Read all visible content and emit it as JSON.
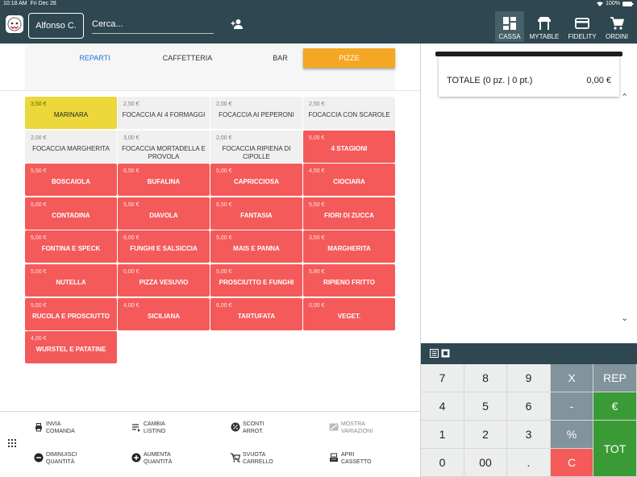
{
  "status": {
    "time": "10:18 AM",
    "date": "Fri Dec 28",
    "battery": "100%"
  },
  "header": {
    "operator": "Alfonso  C.",
    "search_placeholder": "Cerca...",
    "nav": [
      {
        "label": "CASSA",
        "icon": "dashboard-icon",
        "active": true
      },
      {
        "label": "MYTABLE",
        "icon": "table-icon"
      },
      {
        "label": "FIDELITY",
        "icon": "credit-card-icon"
      },
      {
        "label": "ORDINI",
        "icon": "cart-icon"
      }
    ]
  },
  "categories": [
    {
      "label": "REPARTI"
    },
    {
      "label": "CAFFETTERIA"
    },
    {
      "label": "BAR"
    },
    {
      "label": "PIZZE",
      "active": true
    }
  ],
  "colors": {
    "topbar": "#2e4750",
    "accent": "#f5a623",
    "product_red": "#f45a5a",
    "product_yellow": "#ecd83a",
    "product_gray": "#f0f0f0",
    "keypad_green": "#3a9b36",
    "keypad_gray": "#81939b",
    "link_blue": "#1e6fd9"
  },
  "products": [
    {
      "price": "3,50 €",
      "name": "MARINARA",
      "color": "yellow"
    },
    {
      "price": "2,50 €",
      "name": "FOCACCIA AI 4 FORMAGGI",
      "color": "gray"
    },
    {
      "price": "2,00 €",
      "name": "FOCACCIA AI PEPERONI",
      "color": "gray"
    },
    {
      "price": "2,50 €",
      "name": "FOCACCIA CON SCAROLE",
      "color": "gray"
    },
    {
      "price": "2,00 €",
      "name": "FOCACCIA MARGHERITA",
      "color": "gray"
    },
    {
      "price": "3,00 €",
      "name": "FOCACCIA MORTADELLA E PROVOLA",
      "color": "gray"
    },
    {
      "price": "2,00 €",
      "name": "FOCACCIA RIPIENA DI CIPOLLE",
      "color": "gray"
    },
    {
      "price": "5,00 €",
      "name": "4 STAGIONI",
      "color": "red"
    },
    {
      "price": "5,50 €",
      "name": "BOSCAIOLA",
      "color": "red"
    },
    {
      "price": "6,50 €",
      "name": "BUFALINA",
      "color": "red"
    },
    {
      "price": "5,00 €",
      "name": "CAPRICCIOSA",
      "color": "red"
    },
    {
      "price": "4,50 €",
      "name": "CIOCIARA",
      "color": "red"
    },
    {
      "price": "6,00 €",
      "name": "CONTADINA",
      "color": "red"
    },
    {
      "price": "5,50 €",
      "name": "DIAVOLA",
      "color": "red"
    },
    {
      "price": "6,50 €",
      "name": "FANTASIA",
      "color": "red"
    },
    {
      "price": "5,50 €",
      "name": "FIORI DI ZUCCA",
      "color": "red"
    },
    {
      "price": "5,00 €",
      "name": "FONTINA E SPECK",
      "color": "red"
    },
    {
      "price": "6,00 €",
      "name": "FUNGHI E SALSICCIA",
      "color": "red"
    },
    {
      "price": "5,00 €",
      "name": "MAIS E PANNA",
      "color": "red"
    },
    {
      "price": "3,50 €",
      "name": "MARGHERITA",
      "color": "red"
    },
    {
      "price": "5,00 €",
      "name": "NUTELLA",
      "color": "red"
    },
    {
      "price": "0,00 €",
      "name": "PIZZA VESUVIO",
      "color": "red"
    },
    {
      "price": "5,00 €",
      "name": "PROSCIUTTO E FUNGHI",
      "color": "red"
    },
    {
      "price": "5,80 €",
      "name": "RIPIENO FRITTO",
      "color": "red"
    },
    {
      "price": "5,00 €",
      "name": "RUCOLA E PROSCIUTTO",
      "color": "red"
    },
    {
      "price": "4,00 €",
      "name": "SICILIANA",
      "color": "red"
    },
    {
      "price": "6,00 €",
      "name": "TARTUFATA",
      "color": "red"
    },
    {
      "price": "0,00 €",
      "name": "VEGET.",
      "color": "red"
    },
    {
      "price": "4,00 €",
      "name": "WURSTEL E PATATINE",
      "color": "red"
    }
  ],
  "actions": [
    {
      "l1": "INVIA",
      "l2": "COMANDA",
      "icon": "printer-icon"
    },
    {
      "l1": "CAMBIA",
      "l2": "LISTINO",
      "icon": "list-icon"
    },
    {
      "l1": "SCONTI",
      "l2": "ARROT.",
      "icon": "discount-icon"
    },
    {
      "l1": "MOSTRA",
      "l2": "VARIAZIONI",
      "icon": "variations-icon",
      "disabled": true
    },
    {
      "l1": "DIMINUISCI",
      "l2": "QUANTITÀ",
      "icon": "minus-circle-icon"
    },
    {
      "l1": "AUMENTA",
      "l2": "QUANTITÀ",
      "icon": "plus-circle-icon"
    },
    {
      "l1": "SVUOTA",
      "l2": "CARRELLO",
      "icon": "empty-cart-icon"
    },
    {
      "l1": "APRI",
      "l2": "CASSETTO",
      "icon": "cash-register-icon"
    }
  ],
  "receipt": {
    "total_label": "TOTALE (0 pz. | 0 pt.)",
    "total_value": "0,00 €"
  },
  "keypad": [
    {
      "label": "7"
    },
    {
      "label": "8"
    },
    {
      "label": "9"
    },
    {
      "label": "X",
      "style": "gray"
    },
    {
      "label": "REP",
      "style": "gray"
    },
    {
      "label": "4"
    },
    {
      "label": "5"
    },
    {
      "label": "6"
    },
    {
      "label": "-",
      "style": "gray"
    },
    {
      "label": "€",
      "style": "green"
    },
    {
      "label": "1"
    },
    {
      "label": "2"
    },
    {
      "label": "3"
    },
    {
      "label": "%",
      "style": "gray"
    },
    {
      "label": "TOT",
      "style": "green"
    },
    {
      "label": "0"
    },
    {
      "label": "00"
    },
    {
      "label": "."
    },
    {
      "label": "C",
      "style": "red"
    }
  ]
}
